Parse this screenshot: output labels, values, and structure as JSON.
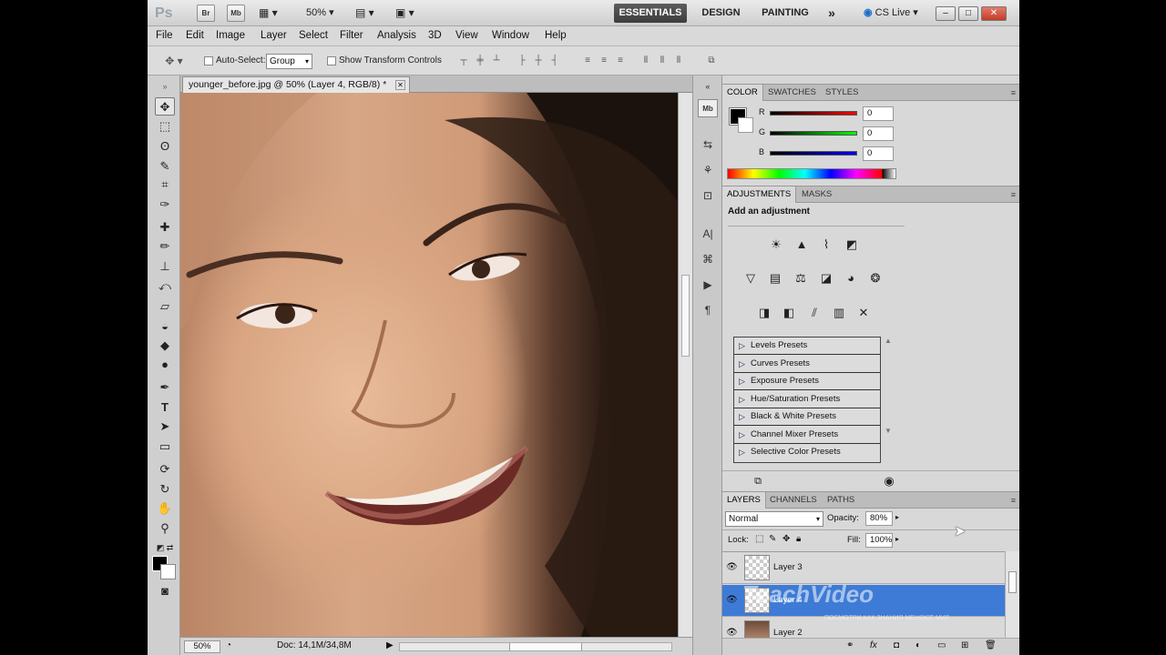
{
  "appbar": {
    "logo": "Ps",
    "br": "Br",
    "mb": "Mb",
    "zoom": "50%",
    "workspaces": [
      "ESSENTIALS",
      "DESIGN",
      "PAINTING"
    ],
    "more": "»",
    "cslive": "CS Live"
  },
  "menu": [
    "File",
    "Edit",
    "Image",
    "Layer",
    "Select",
    "Filter",
    "Analysis",
    "3D",
    "View",
    "Window",
    "Help"
  ],
  "options": {
    "auto_select": "Auto-Select:",
    "auto_select_value": "Group",
    "show_transform": "Show Transform Controls"
  },
  "document": {
    "tab_title": "younger_before.jpg @ 50% (Layer 4, RGB/8) *",
    "status_zoom": "50%",
    "status_doc": "Doc: 14,1M/34,8M"
  },
  "color_panel": {
    "tabs": [
      "COLOR",
      "SWATCHES",
      "STYLES"
    ],
    "channels": [
      {
        "label": "R",
        "value": "0",
        "color": "#d40000"
      },
      {
        "label": "G",
        "value": "0",
        "color": "#00b000"
      },
      {
        "label": "B",
        "value": "0",
        "color": "#0010d0"
      }
    ]
  },
  "adjustments_panel": {
    "tabs": [
      "ADJUSTMENTS",
      "MASKS"
    ],
    "heading": "Add an adjustment",
    "presets": [
      "Levels Presets",
      "Curves Presets",
      "Exposure Presets",
      "Hue/Saturation Presets",
      "Black & White Presets",
      "Channel Mixer Presets",
      "Selective Color Presets"
    ]
  },
  "layers_panel": {
    "tabs": [
      "LAYERS",
      "CHANNELS",
      "PATHS"
    ],
    "blend_mode": "Normal",
    "opacity_label": "Opacity:",
    "opacity_value": "80%",
    "lock_label": "Lock:",
    "fill_label": "Fill:",
    "fill_value": "100%",
    "layers": [
      "Layer 3",
      "Layer 4",
      "Layer 2"
    ]
  },
  "watermark": {
    "brand": "TeachVideo",
    "tagline": "ПОСМОТРИ КАК ЗНАНИЯ МЕНЯЮТ МИР"
  }
}
